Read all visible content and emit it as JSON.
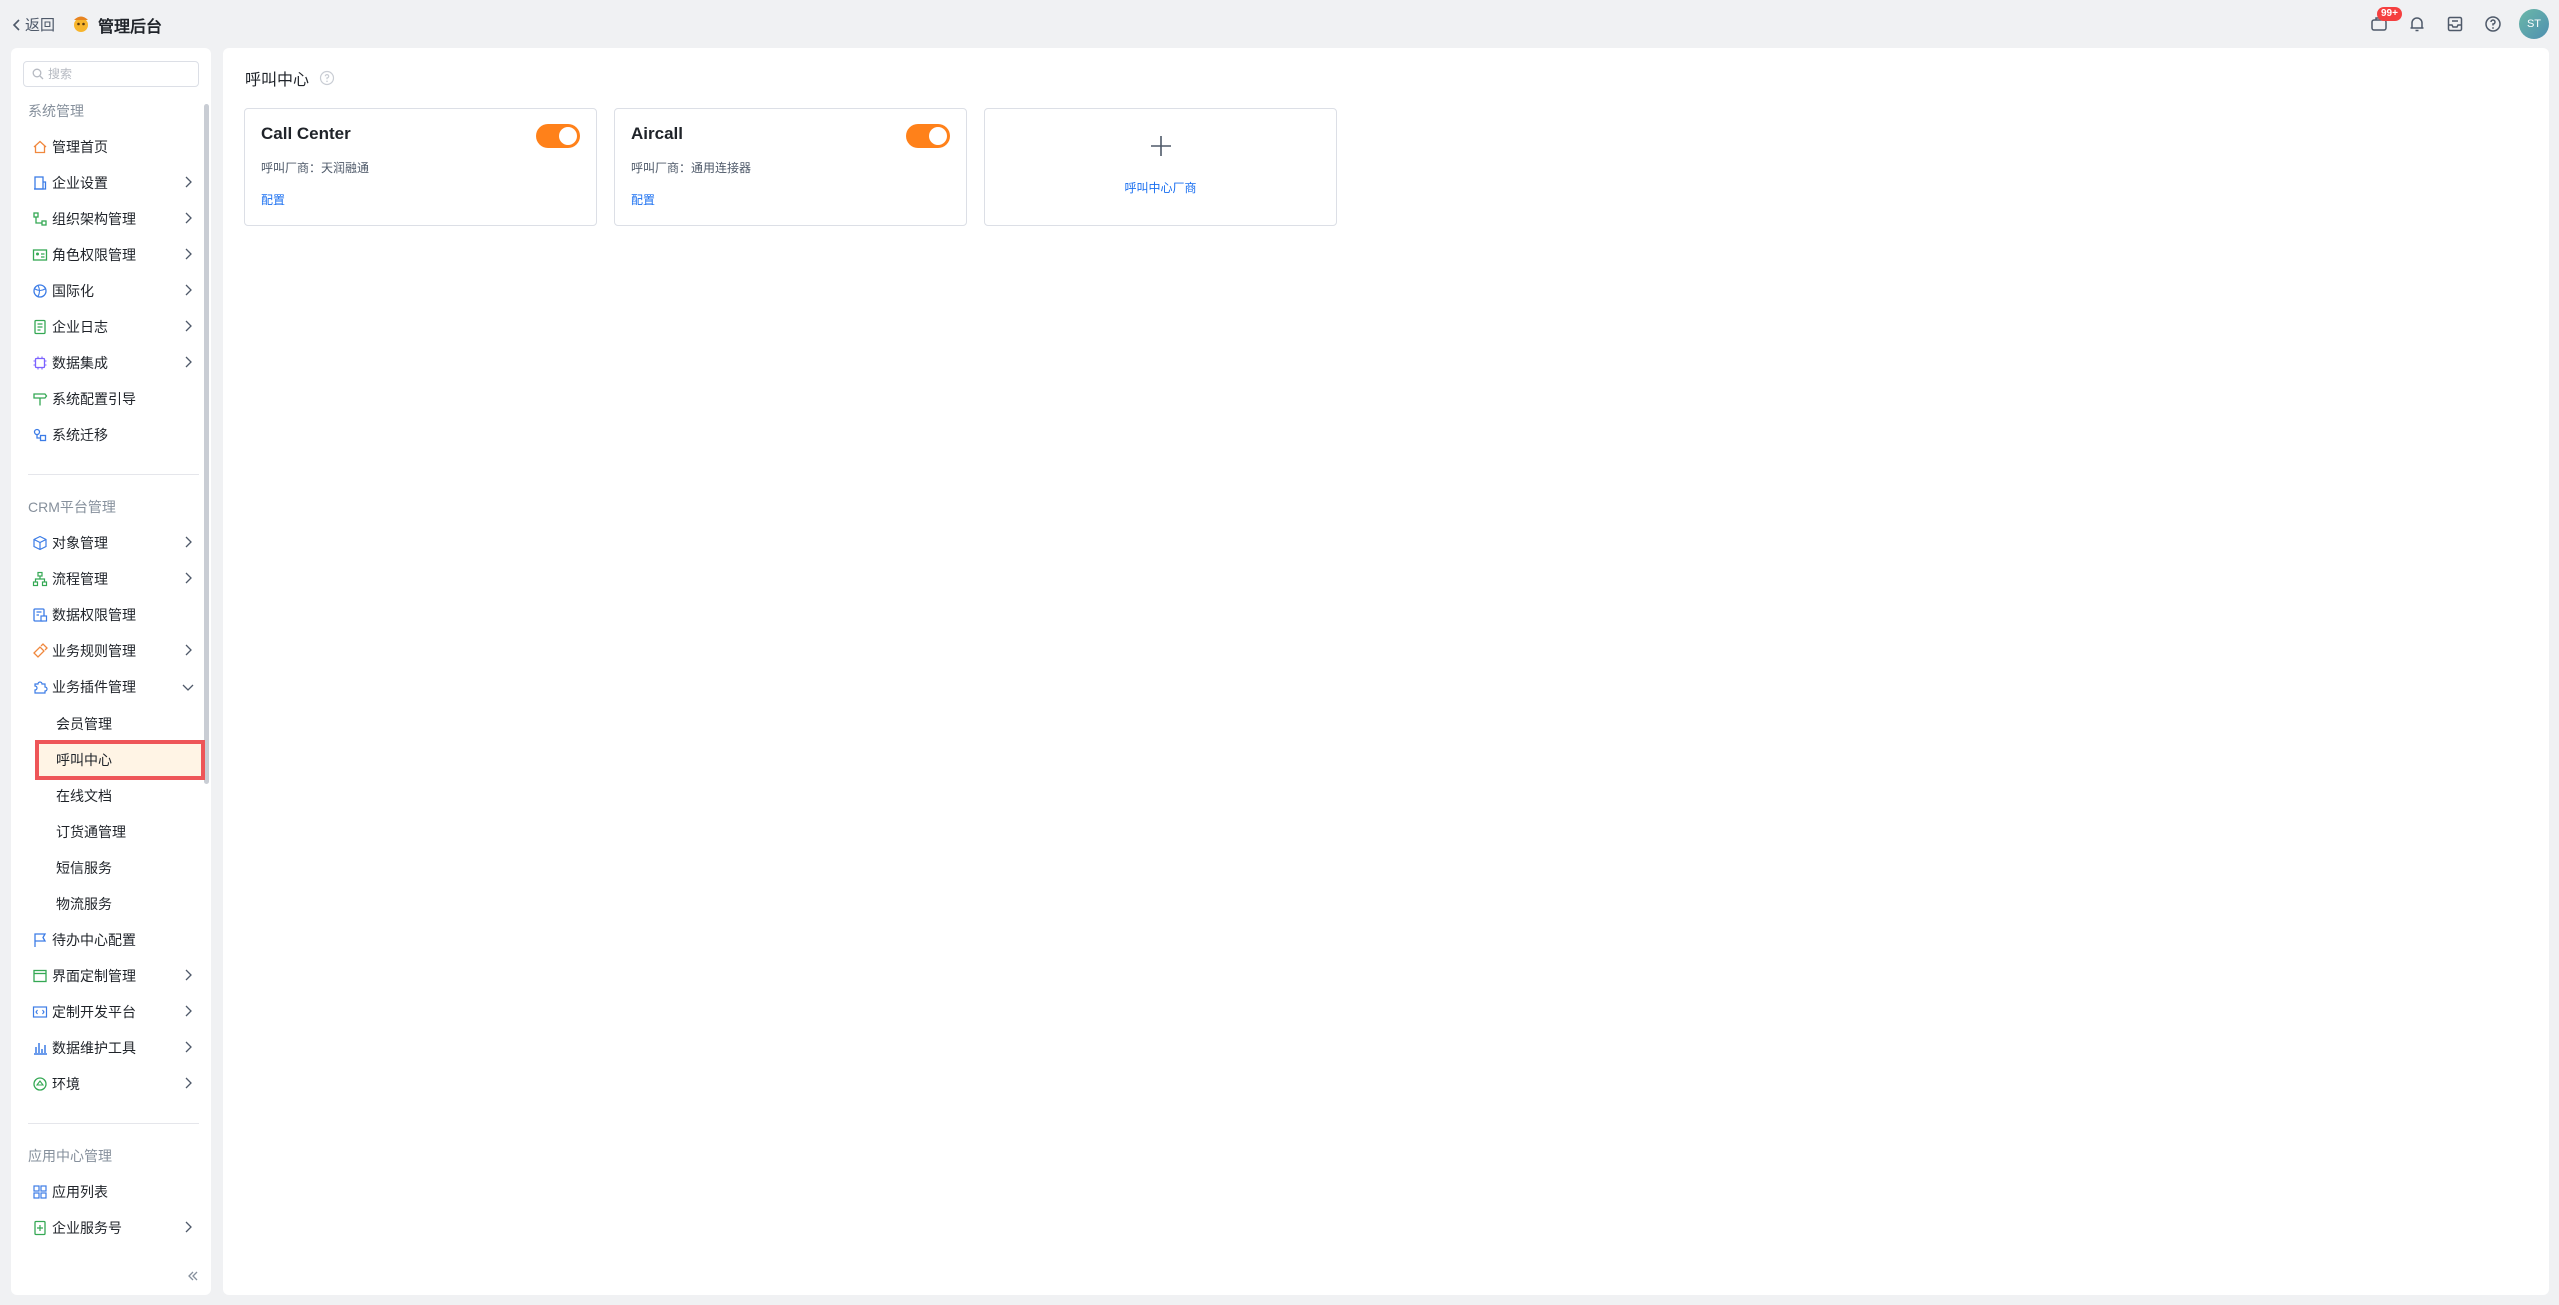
{
  "header": {
    "back_label": "返回",
    "app_title": "管理后台",
    "notification_badge": "99+",
    "avatar_text": "ST"
  },
  "sidebar": {
    "search_placeholder": "搜索",
    "group_system": "系统管理",
    "system_items": [
      {
        "label": "管理首页",
        "icon": "home-icon"
      },
      {
        "label": "企业设置",
        "icon": "building-icon"
      },
      {
        "label": "组织架构管理",
        "icon": "org-icon"
      },
      {
        "label": "角色权限管理",
        "icon": "id-card-icon"
      },
      {
        "label": "国际化",
        "icon": "globe-icon"
      },
      {
        "label": "企业日志",
        "icon": "log-icon"
      },
      {
        "label": "数据集成",
        "icon": "chip-icon"
      },
      {
        "label": "系统配置引导",
        "icon": "signpost-icon"
      },
      {
        "label": "系统迁移",
        "icon": "migrate-icon"
      }
    ],
    "group_crm": "CRM平台管理",
    "crm_items": [
      {
        "label": "对象管理",
        "icon": "cube-icon"
      },
      {
        "label": "流程管理",
        "icon": "flow-icon"
      },
      {
        "label": "数据权限管理",
        "icon": "data-lock-icon"
      },
      {
        "label": "业务规则管理",
        "icon": "rule-icon"
      },
      {
        "label": "业务插件管理",
        "icon": "plugin-icon"
      }
    ],
    "plugin_sub_items": [
      "会员管理",
      "呼叫中心",
      "在线文档",
      "订货通管理",
      "短信服务",
      "物流服务"
    ],
    "crm_items_2": [
      {
        "label": "待办中心配置",
        "icon": "flag-icon"
      },
      {
        "label": "界面定制管理",
        "icon": "layout-icon"
      },
      {
        "label": "定制开发平台",
        "icon": "code-icon"
      },
      {
        "label": "数据维护工具",
        "icon": "bar-chart-icon"
      },
      {
        "label": "环境",
        "icon": "environment-icon"
      }
    ],
    "group_app": "应用中心管理",
    "app_items": [
      {
        "label": "应用列表",
        "icon": "grid-icon"
      },
      {
        "label": "企业服务号",
        "icon": "service-icon"
      }
    ]
  },
  "main": {
    "page_title": "呼叫中心",
    "cards": [
      {
        "name": "Call Center",
        "vendor": "呼叫厂商：天润融通",
        "link": "配置",
        "enabled": true
      },
      {
        "name": "Aircall",
        "vendor": "呼叫厂商：通用连接器",
        "link": "配置",
        "enabled": true
      }
    ],
    "add_card_label": "呼叫中心厂商"
  },
  "colors": {
    "accent_orange": "#ff811a",
    "link_blue": "#1a6ff0",
    "highlight_red": "#ee5558",
    "badge_red": "#f53f3f"
  }
}
